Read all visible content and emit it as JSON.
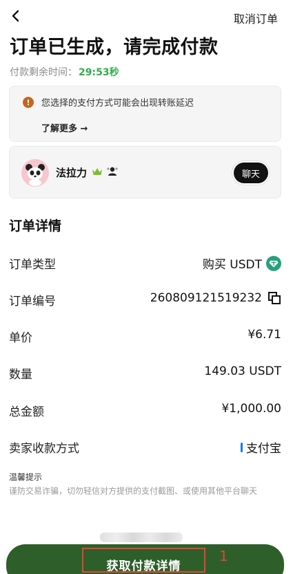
{
  "header": {
    "back_icon": "chevron-left-icon",
    "cancel_label": "取消订单"
  },
  "page_title": "订单已生成，请完成付款",
  "timer": {
    "label": "付款剩余时间：",
    "value": "29:53秒",
    "color": "#2eae4b"
  },
  "notice": {
    "icon": "warning-icon",
    "message": "您选择的支付方式可能会出现转账延迟",
    "learn_more": "了解更多 →"
  },
  "seller": {
    "name": "法拉力",
    "crown_icon": "crown-icon",
    "badge_icon": "verified-user-icon",
    "chat_label": "聊天"
  },
  "details": {
    "title": "订单详情",
    "rows": [
      {
        "label": "订单类型",
        "value": "购买 USDT"
      },
      {
        "label": "订单编号",
        "value": "260809121519232"
      },
      {
        "label": "单价",
        "value": "¥6.71"
      },
      {
        "label": "数量",
        "value": "149.03 USDT"
      },
      {
        "label": "总金额",
        "value": "¥1,000.00"
      },
      {
        "label": "卖家收款方式",
        "value": "支付宝"
      }
    ]
  },
  "tips": {
    "title": "温馨提示",
    "text": "谨防交易诈骗，切勿轻信对方提供的支付截图、或使用其他平台聊天"
  },
  "cta": {
    "label": "获取付款详情",
    "annotation": "1",
    "color": "#2e5f2a"
  }
}
